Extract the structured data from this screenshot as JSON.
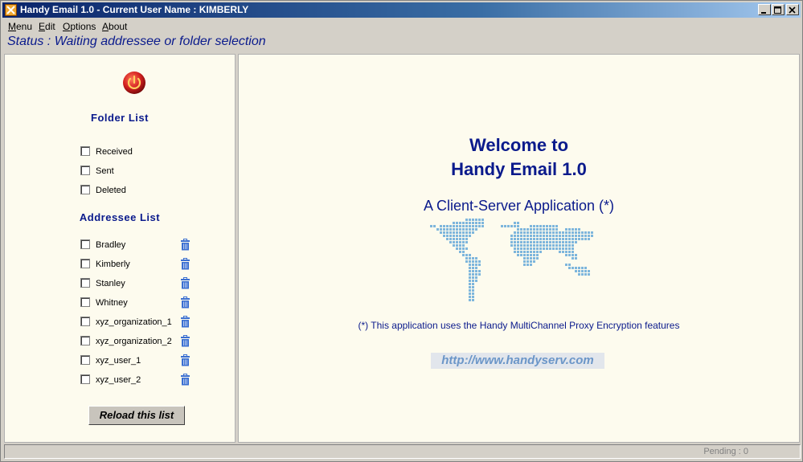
{
  "window": {
    "title": "Handy Email 1.0 - Current User Name : KIMBERLY"
  },
  "menubar": {
    "items": [
      {
        "label": "Menu",
        "access": "M"
      },
      {
        "label": "Edit",
        "access": "E"
      },
      {
        "label": "Options",
        "access": "O"
      },
      {
        "label": "About",
        "access": "A"
      }
    ]
  },
  "status": {
    "text": "Status : Waiting addressee or folder selection"
  },
  "left_panel": {
    "folder_title": "Folder List",
    "folders": [
      "Received",
      "Sent",
      "Deleted"
    ],
    "addressee_title": "Addressee List",
    "addressees": [
      "Bradley",
      "Kimberly",
      "Stanley",
      "Whitney",
      "xyz_organization_1",
      "xyz_organization_2",
      "xyz_user_1",
      "xyz_user_2"
    ],
    "reload_label": "Reload this list"
  },
  "main": {
    "welcome_line1": "Welcome to",
    "welcome_line2": "Handy Email 1.0",
    "subtitle": "A Client-Server Application (*)",
    "note": "(*) This application uses the Handy MultiChannel Proxy Encryption features",
    "link": "http://www.handyserv.com"
  },
  "statusbar": {
    "pending": "Pending : 0"
  },
  "colors": {
    "title_gradient_start": "#0a246a",
    "accent_text": "#0a1a8c",
    "panel_bg": "#fdfbee",
    "map_dots": "#7eb6dc",
    "power_icon": "#d42020"
  }
}
